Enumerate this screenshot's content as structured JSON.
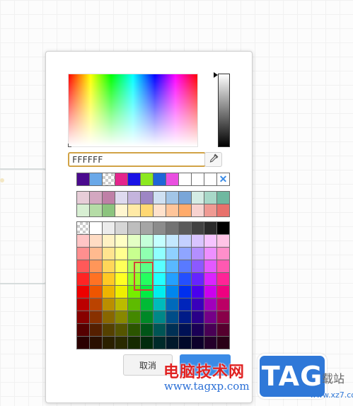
{
  "color_picker": {
    "hex_value": "FFFFFF",
    "cancel_label": "取消",
    "confirm_label": "",
    "recent_colors": [
      "#4a0a8e",
      "#6aa8e8",
      "checker",
      "#e4258c",
      "#1a12e6",
      "#8ce81f",
      "#1f66d8",
      "#e94fe0",
      "",
      "",
      "",
      "clear"
    ],
    "theme_colors": [
      [
        "#e7cdd8",
        "#d3a7c0",
        "#bf80a7",
        "#dedaef",
        "#c4b4dd",
        "#9d86c4",
        "#cfe0f2",
        "#a2c5e7",
        "#7aa6d8",
        "#d4ece4",
        "#a8d8c8",
        "#6fb8a0"
      ],
      [
        "#d8efd3",
        "#b5dca6",
        "#8cc47e",
        "#fff6d0",
        "#ffeaa6",
        "#ffd873",
        "#ffe2cc",
        "#ffc59a",
        "#ffab6b",
        "#f7d2cf",
        "#ef9a93",
        "#e8716c"
      ]
    ],
    "palette": [
      [
        "checker",
        "#ffffff",
        "#ececec",
        "#d6d6d6",
        "#bebebe",
        "#a5a5a5",
        "#8c8c8c",
        "#737373",
        "#5a5a5a",
        "#424242",
        "#2a2a2a",
        "#000000"
      ],
      [
        "#ffc5c5",
        "#ffdcc4",
        "#fff2c4",
        "#ffffc4",
        "#e4ffc4",
        "#c4ffd9",
        "#c4ffff",
        "#c4e8ff",
        "#c4d0ff",
        "#d9c4ff",
        "#f6c4ff",
        "#ffc4e6"
      ],
      [
        "#ff8f8f",
        "#ffba8f",
        "#ffe48f",
        "#ffff8f",
        "#c8ff8f",
        "#8fffb0",
        "#8fffff",
        "#8fd0ff",
        "#8fa5ff",
        "#b38fff",
        "#ed8fff",
        "#ff8fcb"
      ],
      [
        "#ff5959",
        "#ff9659",
        "#ffd659",
        "#ffff59",
        "#adff59",
        "#59ff88",
        "#59ffff",
        "#59b8ff",
        "#597aff",
        "#8c59ff",
        "#e359ff",
        "#ff59b1"
      ],
      [
        "#ff2424",
        "#ff7224",
        "#ffc924",
        "#ffff24",
        "#92ff24",
        "#24ff60",
        "#24ffff",
        "#24a0ff",
        "#244fff",
        "#6624ff",
        "#da24ff",
        "#ff2497"
      ],
      [
        "#ee0000",
        "#ee5500",
        "#eeb400",
        "#eeee00",
        "#77ee00",
        "#00ee44",
        "#00eeee",
        "#0086ee",
        "#002fee",
        "#4a00ee",
        "#cc00ee",
        "#ee0080"
      ],
      [
        "#bb0000",
        "#bb4300",
        "#bb8e00",
        "#bbbb00",
        "#5e bb00",
        "#00bb36",
        "#00bbbb",
        "#006abb",
        "#0025bb",
        "#3a00bb",
        "#a100bb",
        "#bb0065"
      ],
      [
        "#880000",
        "#883100",
        "#886700",
        "#888800",
        "#448800",
        "#008827",
        "#008888",
        "#004d88",
        "#001b88",
        "#2a0088",
        "#750088",
        "#880049"
      ],
      [
        "#550000",
        "#551f00",
        "#554100",
        "#555500",
        "#2b5500",
        "#005518",
        "#005555",
        "#003055",
        "#001155",
        "#1a0055",
        "#490055",
        "#55002e"
      ],
      [
        "#2a0000",
        "#2a0f00",
        "#2a2000",
        "#2a2a00",
        "#152a00",
        "#002a0c",
        "#002a2a",
        "#00182a",
        "#00082a",
        "#0d002a",
        "#24002a",
        "#2a0017"
      ]
    ],
    "accent_color": "#3b8be6",
    "focus_color": "#d1a346"
  },
  "watermark": {
    "site_name": "电脑技术网",
    "url": "www.tagxp.com",
    "tag": "TAG",
    "side_text": "载站",
    "side_url": "www.xz7.com"
  }
}
